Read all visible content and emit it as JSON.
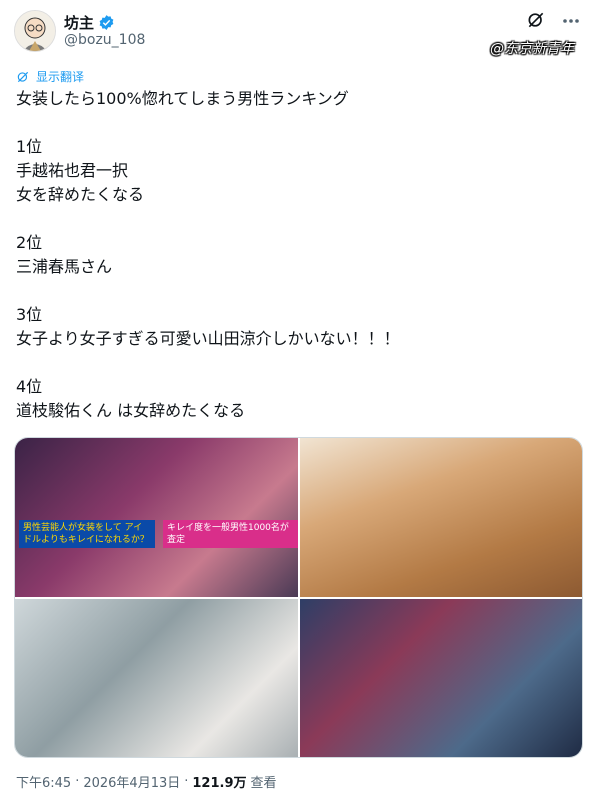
{
  "author": {
    "display_name": "坊主",
    "handle": "@bozu_108",
    "verified_color": "#1d9bf0"
  },
  "watermark": "@东京新青年",
  "translate_label": "显示翻译",
  "tweet_text": "女装したら100%惚れてしまう男性ランキング\n\n1位\n手越祐也君一択\n女を辞めたくなる\n\n2位\n三浦春馬さん\n\n3位\n女子より女子すぎる可愛い山田涼介しかいない！！！\n\n4位\n道枝駿佑くん は女辞めたくなる",
  "media": {
    "m1_caption_left": "男性芸能人が女装をして アイドルよりもキレイになれるか？",
    "m1_caption_right": "キレイ度を一般男性1000名が査定"
  },
  "footer": {
    "time": "下午6:45",
    "separator1": "·",
    "date": "2026年4月13日",
    "separator2": "·",
    "views": "121.9万",
    "views_label": "查看"
  },
  "icons": [
    "avatar",
    "verified-icon",
    "grok-icon",
    "more-icon",
    "translate-icon"
  ]
}
